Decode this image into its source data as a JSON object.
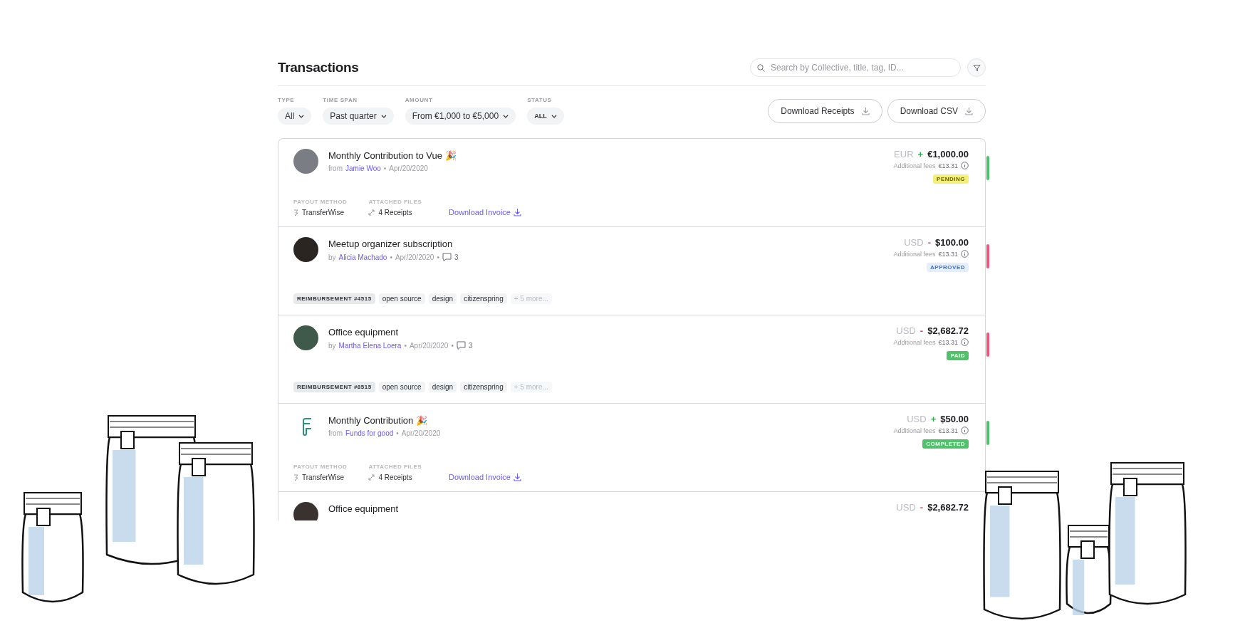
{
  "header": {
    "title": "Transactions",
    "search": {
      "placeholder": "Search by Collective, title, tag, ID..."
    }
  },
  "filters": [
    {
      "label": "TYPE",
      "value": "All"
    },
    {
      "label": "TIME SPAN",
      "value": "Past quarter"
    },
    {
      "label": "AMOUNT",
      "value": "From €1,000 to €5,000"
    },
    {
      "label": "STATUS",
      "value": "ALL"
    }
  ],
  "actions": [
    "Download Receipts",
    "Download CSV"
  ],
  "transactions": [
    {
      "kind": "payout",
      "avatar": {
        "kind": "photo"
      },
      "title": "Monthly Contribution to Vue",
      "emoji": "🎉",
      "prefix": "from",
      "person": "Jamie Woo",
      "separators": [
        "•"
      ],
      "date": "Apr/20/2020",
      "currency": "EUR",
      "sign": {
        "kind": "credit",
        "text": "+"
      },
      "amount": "€1,000.00",
      "fees_label": "Additional fees",
      "fees": "€13.31",
      "status": {
        "kind": "pending",
        "label": "PENDING"
      },
      "color": "#4cc26b",
      "payout_label": "PAYOUT METHOD",
      "payout": "TransferWise",
      "files_label": "ATTACHED FILES",
      "files": "4 Receipts",
      "invoice": "Download Invoice"
    },
    {
      "kind": "expense",
      "avatar": {
        "kind": "photo"
      },
      "title": "Meetup organizer subscription",
      "prefix": "by",
      "person": "Alicia Machado",
      "separators": [
        "•",
        "•"
      ],
      "date": "Apr/20/2020",
      "comments": "3",
      "currency": "USD",
      "sign": {
        "kind": "debit",
        "text": "-"
      },
      "amount": "$100.00",
      "fees_label": "Additional fees",
      "fees": "€13.31",
      "status": {
        "kind": "approved",
        "label": "APPROVED"
      },
      "color": "#f0557a",
      "tags": [
        "REIMBURSEMENT #4515",
        "open source",
        "design",
        "citizenspring"
      ],
      "more": "+ 5 more..."
    },
    {
      "kind": "expense",
      "avatar": {
        "kind": "photo"
      },
      "title": "Office equipment",
      "prefix": "by",
      "person": "Martha Elena Loera",
      "separators": [
        "•",
        "•"
      ],
      "date": "Apr/20/2020",
      "comments": "3",
      "currency": "USD",
      "sign": {
        "kind": "debit",
        "text": "-"
      },
      "amount": "$2,682.72",
      "fees_label": "Additional fees",
      "fees": "€13.31",
      "status": {
        "kind": "paid",
        "label": "PAID"
      },
      "color": "#f0557a",
      "tags": [
        "REIMBURSEMENT #8515",
        "open source",
        "design",
        "citizenspring"
      ],
      "more": "+ 5 more..."
    },
    {
      "kind": "payout",
      "avatar": {
        "kind": "logo"
      },
      "title": "Monthly Contribution",
      "emoji": "🎉",
      "prefix": "from",
      "person": "Funds for good",
      "separators": [
        "•"
      ],
      "date": "Apr/20/2020",
      "currency": "USD",
      "sign": {
        "kind": "credit",
        "text": "+"
      },
      "amount": "$50.00",
      "fees_label": "Additional fees",
      "fees": "€13.31",
      "status": {
        "kind": "completed",
        "label": "COMPLETED"
      },
      "color": "#4cc26b",
      "payout_label": "PAYOUT METHOD",
      "payout": "TransferWise",
      "files_label": "ATTACHED FILES",
      "files": "4 Receipts",
      "invoice": "Download Invoice"
    },
    {
      "kind": "cut",
      "avatar": {
        "kind": "photo"
      },
      "title": "Office equipment",
      "currency": "USD",
      "sign": {
        "kind": "debit",
        "text": "-"
      },
      "amount": "$2,682.72"
    }
  ]
}
